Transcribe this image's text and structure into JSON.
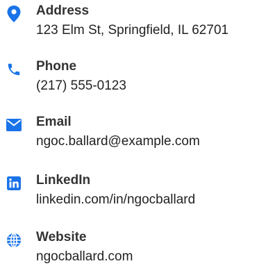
{
  "accent_color": "#1a73e8",
  "contacts": [
    {
      "icon": "map-pin-icon",
      "label": "Address",
      "value": "123 Elm St, Springfield, IL 62701"
    },
    {
      "icon": "phone-icon",
      "label": "Phone",
      "value": "(217) 555-0123"
    },
    {
      "icon": "envelope-icon",
      "label": "Email",
      "value": "ngoc.ballard@example.com"
    },
    {
      "icon": "linkedin-icon",
      "label": "LinkedIn",
      "value": "linkedin.com/in/ngocballard"
    },
    {
      "icon": "globe-icon",
      "label": "Website",
      "value": "ngocballard.com"
    }
  ]
}
